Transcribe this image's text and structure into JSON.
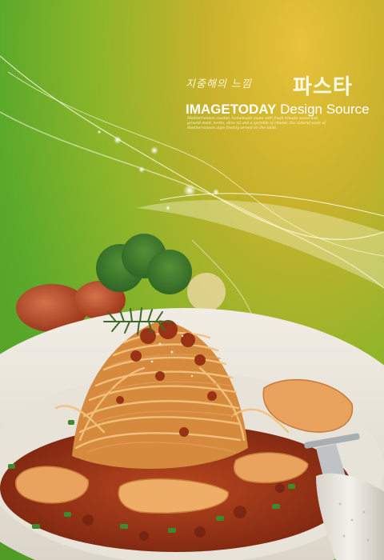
{
  "poster": {
    "korean_subtitle": "지중해의 느낌",
    "korean_title": "파스타",
    "brand_bold": "IMAGETODAY",
    "brand_rest": " Design Source",
    "blurb": "Mediterranean cuisine, homemade pasta with fresh tomato sauce and ground meat, herbs, olive oil and a sprinkle of cheese; the natural taste of Mediterranean style freshly served on the table.",
    "colors": {
      "background_top": "#e8c23a",
      "background_bottom": "#4f9b26",
      "text": "#ffffff",
      "sauce": "#a3341b",
      "noodle": "#e9b46a"
    }
  }
}
